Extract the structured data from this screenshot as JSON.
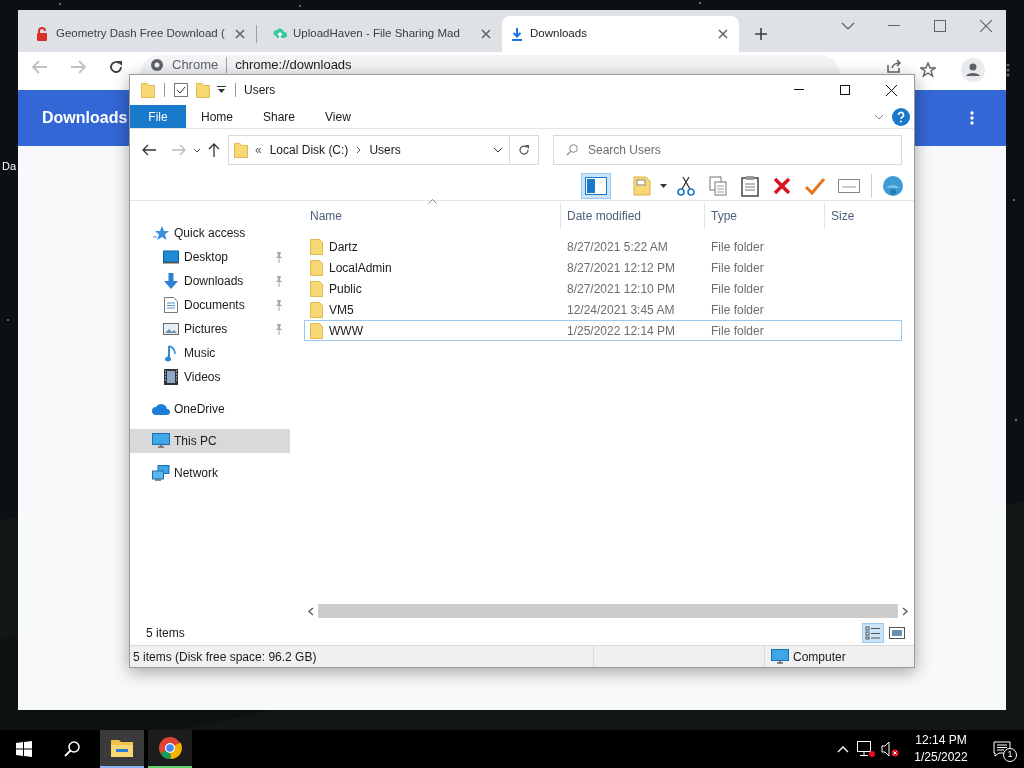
{
  "desktop": {
    "icon_label": "Da"
  },
  "browser": {
    "tabs": [
      {
        "title": "Geometry Dash Free Download (",
        "kind": "locked",
        "selected": false
      },
      {
        "title": "UploadHaven - File Sharing Mad",
        "kind": "upload",
        "selected": false
      },
      {
        "title": "Downloads",
        "kind": "download",
        "selected": true
      }
    ],
    "omnibox": {
      "chip": "Chrome",
      "url": "chrome://downloads"
    },
    "page_title": "Downloads"
  },
  "explorer": {
    "title": "Users",
    "ribbon_tabs": [
      {
        "label": "File",
        "kind": "file"
      },
      {
        "label": "Home",
        "kind": "tab"
      },
      {
        "label": "Share",
        "kind": "tab"
      },
      {
        "label": "View",
        "kind": "tab"
      }
    ],
    "address_overflow": "«",
    "address": [
      "Local Disk (C:)",
      "Users"
    ],
    "search": {
      "placeholder": "Search Users"
    },
    "nav": [
      {
        "label": "Quick access",
        "kind": "star",
        "selected": false,
        "children": [
          {
            "label": "Desktop",
            "kind": "desktop",
            "pinned": true
          },
          {
            "label": "Downloads",
            "kind": "downloads",
            "pinned": true
          },
          {
            "label": "Documents",
            "kind": "documents",
            "pinned": true
          },
          {
            "label": "Pictures",
            "kind": "pictures",
            "pinned": true
          },
          {
            "label": "Music",
            "kind": "music",
            "pinned": false
          },
          {
            "label": "Videos",
            "kind": "videos",
            "pinned": false
          }
        ]
      },
      {
        "label": "OneDrive",
        "kind": "cloud",
        "selected": false
      },
      {
        "label": "This PC",
        "kind": "pc",
        "selected": true
      },
      {
        "label": "Network",
        "kind": "network",
        "selected": false
      }
    ],
    "columns": [
      "Name",
      "Date modified",
      "Type",
      "Size"
    ],
    "rows": [
      {
        "name": "Dartz",
        "date": "8/27/2021 5:22 AM",
        "type": "File folder",
        "focused": false
      },
      {
        "name": "LocalAdmin",
        "date": "8/27/2021 12:12 PM",
        "type": "File folder",
        "focused": false
      },
      {
        "name": "Public",
        "date": "8/27/2021 12:10 PM",
        "type": "File folder",
        "focused": false
      },
      {
        "name": "VM5",
        "date": "12/24/2021 3:45 AM",
        "type": "File folder",
        "focused": false
      },
      {
        "name": "WWW",
        "date": "1/25/2022 12:14 PM",
        "type": "File folder",
        "focused": true
      }
    ],
    "item_count": "5 items",
    "status": "5 items (Disk free space: 96.2 GB)",
    "location": "Computer"
  },
  "taskbar": {
    "apps": [
      {
        "kind": "explorer",
        "active": true
      },
      {
        "kind": "chrome",
        "active": false
      }
    ],
    "time": "12:14 PM",
    "date": "1/25/2022",
    "notifications": "1"
  }
}
